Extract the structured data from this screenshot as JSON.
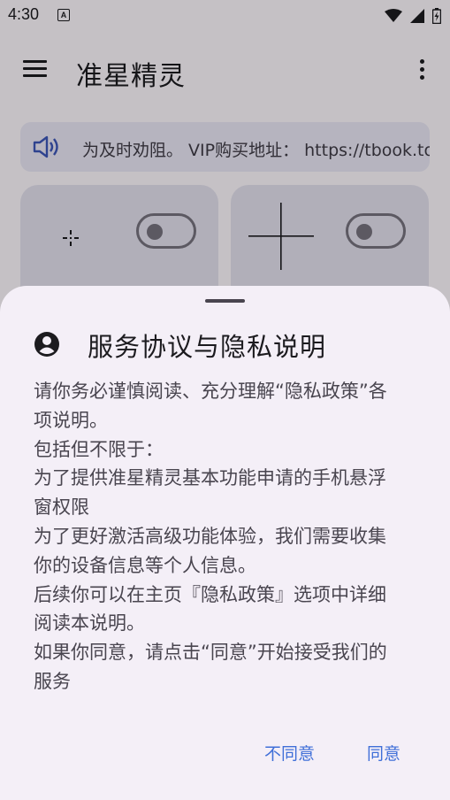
{
  "status_bar": {
    "time": "4:30",
    "notification_icon_letter": "A",
    "icons": [
      "wifi-icon",
      "signal-icon",
      "battery-charging-icon"
    ]
  },
  "app_bar": {
    "title": "准星精灵",
    "menu_icon": "menu-icon",
    "more_icon": "more-vert-icon"
  },
  "notice": {
    "icon": "speaker-icon",
    "text": "为及时劝阻。 VIP购买地址： https://tbook.top"
  },
  "cards": [
    {
      "icon": "small-crosshair-icon",
      "toggle_on": false
    },
    {
      "icon": "large-crosshair-icon",
      "toggle_on": false
    }
  ],
  "dialog": {
    "icon": "account-circle-icon",
    "title": "服务协议与隐私说明",
    "body_lines": [
      "请你务必谨慎阅读、充分理解“隐私政策”各",
      "项说明。",
      "包括但不限于：",
      "为了提供准星精灵基本功能申请的手机悬浮",
      "窗权限",
      "为了更好激活高级功能体验，我们需要收集",
      "你的设备信息等个人信息。",
      "后续你可以在主页『隐私政策』选项中详细",
      "阅读本说明。",
      "如果你同意，请点击“同意”开始接受我们的",
      "服务"
    ],
    "disagree_label": "不同意",
    "agree_label": "同意"
  },
  "colors": {
    "accent": "#3f6fd8",
    "sheet_background": "#f4eff7",
    "card_background": "#e3e1ee"
  }
}
